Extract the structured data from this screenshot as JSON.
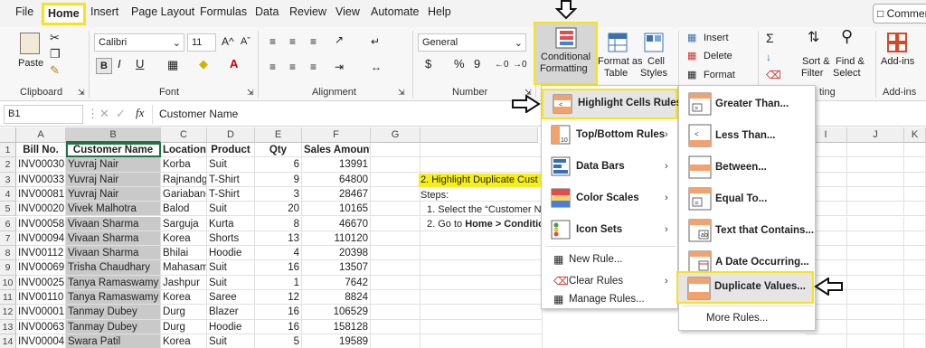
{
  "tabs": [
    "File",
    "Home",
    "Insert",
    "Page Layout",
    "Formulas",
    "Data",
    "Review",
    "View",
    "Automate",
    "Help"
  ],
  "comments_label": "Commer",
  "ribbon": {
    "clipboard": {
      "paste": "Paste",
      "label": "Clipboard"
    },
    "font": {
      "name": "Calibri",
      "size": "11",
      "label": "Font",
      "bold": "B",
      "italic": "I",
      "underline": "U",
      "grow": "A^",
      "shrink": "Aˇ"
    },
    "alignment": {
      "label": "Alignment"
    },
    "number": {
      "format": "General",
      "label": "Number",
      "currency": "$",
      "percent": "%",
      "comma": "9"
    },
    "cf": {
      "line1": "Conditional",
      "line2": "Formatting"
    },
    "fat": {
      "line1": "Format as",
      "line2": "Table"
    },
    "cs": {
      "line1": "Cell",
      "line2": "Styles"
    },
    "cells": {
      "insert": "Insert",
      "delete": "Delete",
      "format": "Format"
    },
    "editing": {
      "sort1": "Sort &",
      "sort2": "Filter",
      "find1": "Find &",
      "find2": "Select"
    },
    "addins": {
      "btn": "Add-ins",
      "label": "Add-ins"
    },
    "editing_label_partial": "ting"
  },
  "formula_bar": {
    "namebox": "B1",
    "fx": "fx",
    "content": "Customer Name"
  },
  "columns": [
    "A",
    "B",
    "C",
    "D",
    "E",
    "F",
    "G",
    "H",
    "I",
    "J",
    "K"
  ],
  "headers": [
    "Bill No.",
    "Customer Name",
    "Location",
    "Product",
    "Qty",
    "Sales Amount"
  ],
  "rows": [
    [
      "INV00030",
      "Yuvraj Nair",
      "Korba",
      "Suit",
      "6",
      "13991"
    ],
    [
      "INV00033",
      "Yuvraj Nair",
      "Rajnandga",
      "T-Shirt",
      "9",
      "64800"
    ],
    [
      "INV00081",
      "Yuvraj Nair",
      "Gariaband",
      "T-Shirt",
      "3",
      "28467"
    ],
    [
      "INV00020",
      "Vivek Malhotra",
      "Balod",
      "Suit",
      "20",
      "10165"
    ],
    [
      "INV00058",
      "Vivaan Sharma",
      "Sarguja",
      "Kurta",
      "8",
      "46670"
    ],
    [
      "INV00094",
      "Vivaan Sharma",
      "Korea",
      "Shorts",
      "13",
      "110120"
    ],
    [
      "INV00112",
      "Vivaan Sharma",
      "Bhilai",
      "Hoodie",
      "4",
      "20398"
    ],
    [
      "INV00069",
      "Trisha Chaudhary",
      "Mahasam",
      "Suit",
      "16",
      "13507"
    ],
    [
      "INV00025",
      "Tanya Ramaswamy",
      "Jashpur",
      "Suit",
      "1",
      "7642"
    ],
    [
      "INV00110",
      "Tanya Ramaswamy",
      "Korea",
      "Saree",
      "12",
      "8824"
    ],
    [
      "INV00001",
      "Tanmay Dubey",
      "Durg",
      "Blazer",
      "16",
      "106529"
    ],
    [
      "INV00063",
      "Tanmay Dubey",
      "Durg",
      "Hoodie",
      "16",
      "158128"
    ],
    [
      "INV00004",
      "Swara Patil",
      "Korea",
      "Suit",
      "5",
      "19589"
    ]
  ],
  "row_numbers": [
    "1",
    "2",
    "3",
    "4",
    "5",
    "6",
    "7",
    "8",
    "9",
    "10",
    "11",
    "12",
    "13",
    "14"
  ],
  "notes": {
    "title": "2. Highlight Duplicate Cust",
    "steps": "Steps:",
    "s1": "1. Select the “Customer N",
    "s2a": "2. Go to ",
    "s2b": "Home > Conditio"
  },
  "menu1": [
    "Highlight Cells Rules",
    "Top/Bottom Rules",
    "Data Bars",
    "Color Scales",
    "Icon Sets",
    "New Rule...",
    "Clear Rules",
    "Manage Rules..."
  ],
  "menu2": [
    "Greater Than...",
    "Less Than...",
    "Between...",
    "Equal To...",
    "Text that Contains...",
    "A Date Occurring...",
    "Duplicate Values...",
    "More Rules..."
  ],
  "colors": {
    "highlight": "#f6e31c",
    "selected_fill": "#c9c9c9",
    "grid_header": "#f0f0f0"
  }
}
